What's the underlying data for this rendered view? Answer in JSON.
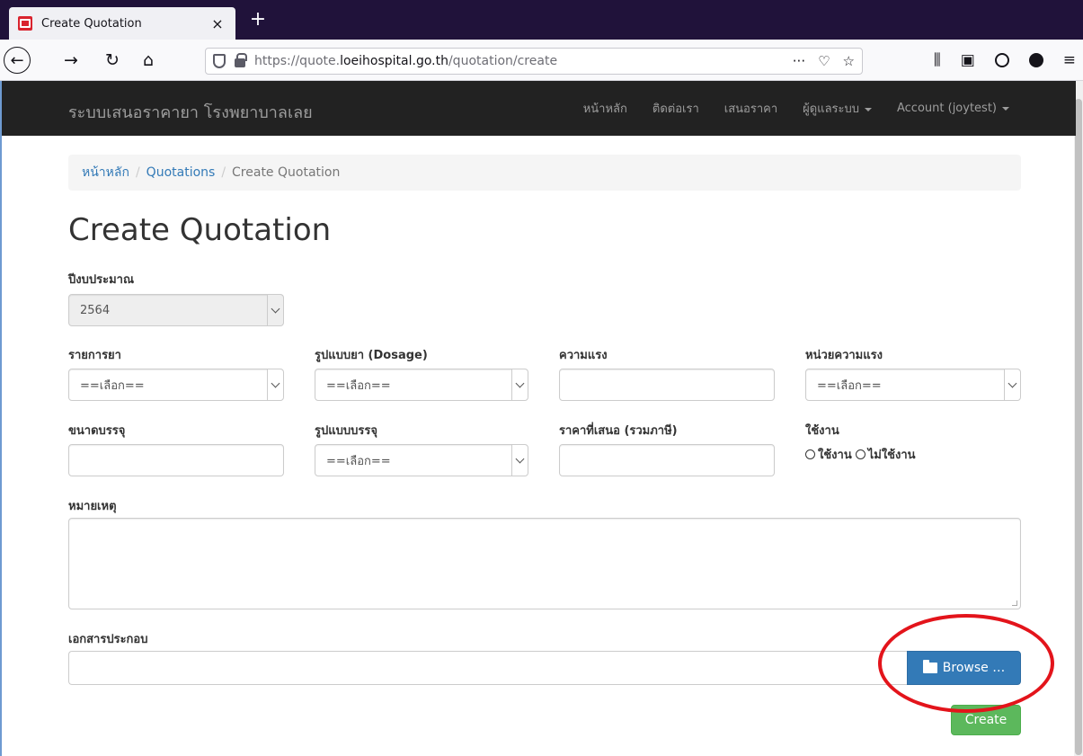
{
  "browser": {
    "tab_title": "Create Quotation",
    "tab_close": "×",
    "new_tab": "+",
    "url_prefix": "https://quote.",
    "url_domain": "loeihospital.go.th",
    "url_path": "/quotation/create",
    "url_more": "···",
    "icons": [
      "back-icon",
      "forward-icon",
      "reload-icon",
      "home-icon",
      "shield-icon",
      "lock-icon",
      "pocket-icon",
      "bookmark-star-icon",
      "library-icon",
      "sidebar-icon",
      "account-icon",
      "extension-icon",
      "menu-icon"
    ]
  },
  "site": {
    "brand": "ระบบเสนอราคายา โรงพยาบาลเลย",
    "nav": [
      "หน้าหลัก",
      "ติดต่อเรา",
      "เสนอราคา",
      "ผู้ดูแลระบบ",
      "Account (joytest)"
    ]
  },
  "breadcrumb": {
    "home": "หน้าหลัก",
    "quotations": "Quotations",
    "current": "Create Quotation",
    "sep": "/"
  },
  "page_title": "Create Quotation",
  "form": {
    "budget_year_label": "ปีงบประมาณ",
    "budget_year_value": "2564",
    "drug_label": "รายการยา",
    "drug_value": "==เลือก==",
    "dosage_label": "รูปแบบยา (Dosage)",
    "dosage_value": "==เลือก==",
    "strength_label": "ความแรง",
    "strength_value": "",
    "strength_unit_label": "หน่วยความแรง",
    "strength_unit_value": "==เลือก==",
    "pack_size_label": "ขนาดบรรจุ",
    "pack_size_value": "",
    "pack_type_label": "รูปแบบบรรจุ",
    "pack_type_value": "==เลือก==",
    "price_label": "ราคาที่เสนอ (รวมภาษี)",
    "price_value": "",
    "status_label": "ใช้งาน",
    "status_active": "ใช้งาน",
    "status_inactive": "ไม่ใช้งาน",
    "remark_label": "หมายเหตุ",
    "attachment_label": "เอกสารประกอบ",
    "browse_label": "Browse …",
    "create_label": "Create"
  },
  "colors": {
    "navbar": "#222222",
    "link": "#337ab7",
    "browse": "#337ab7",
    "create": "#5cb85c",
    "annotation": "#e3141b"
  }
}
